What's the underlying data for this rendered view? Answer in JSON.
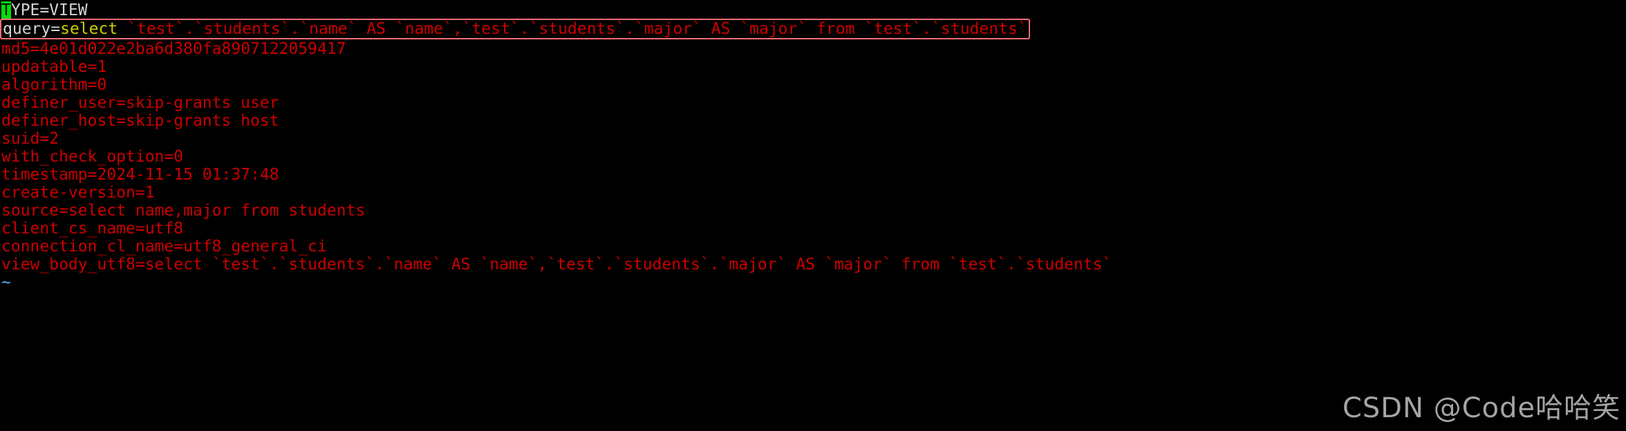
{
  "terminal": {
    "background_color": "#000000",
    "default_text_color": "#cc0000",
    "cursor_color": "#00e000",
    "highlight_border_color": "#fc6b75",
    "keyword_color": "#cdcd00",
    "header_text_color": "#d4d4d4",
    "tilde_color": "#5fafff"
  },
  "lines": {
    "type_line": {
      "cursor_char": "T",
      "rest": "YPE=VIEW"
    },
    "query_line": {
      "key": "query=",
      "keyword": "select",
      "value": " `test`.`students`.`name` AS `name`,`test`.`students`.`major` AS `major` from `test`.`students`"
    },
    "md5": "md5=4e01d022e2ba6d380fa8907122059417",
    "updatable": "updatable=1",
    "algorithm": "algorithm=0",
    "definer_user": "definer_user=skip-grants user",
    "definer_host": "definer_host=skip-grants host",
    "suid": "suid=2",
    "with_check_option": "with_check_option=0",
    "timestamp": "timestamp=2024-11-15 01:37:48",
    "create_version": "create-version=1",
    "source": "source=select name,major from students",
    "client_cs_name": "client_cs_name=utf8",
    "connection_cl_name": "connection_cl_name=utf8_general_ci",
    "view_body_utf8": "view_body_utf8=select `test`.`students`.`name` AS `name`,`test`.`students`.`major` AS `major` from `test`.`students`",
    "tilde": "~"
  },
  "watermark": {
    "text": "CSDN @Code哈哈笑"
  }
}
